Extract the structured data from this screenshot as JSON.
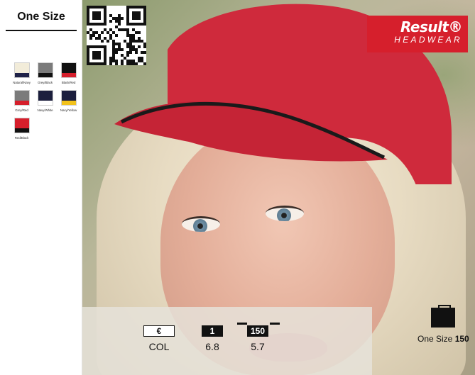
{
  "size_panel": {
    "title": "One Size"
  },
  "swatches": [
    {
      "label": "Natural/Navy",
      "main": "#f2ecd9",
      "band": "#1f2248"
    },
    {
      "label": "Grey/Black",
      "main": "#7b7b7b",
      "band": "#111111"
    },
    {
      "label": "Black/Red",
      "main": "#111111",
      "band": "#d61f2c"
    },
    {
      "label": "Grey/Red",
      "main": "#7b7b7b",
      "band": "#d61f2c"
    },
    {
      "label": "Navy/White",
      "main": "#1c1f3d",
      "band": "#ffffff"
    },
    {
      "label": "Navy/Yellow",
      "main": "#1c1f3d",
      "band": "#f2c21b"
    },
    {
      "label": "Red/Black",
      "main": "#d61f2c",
      "band": "#111111"
    }
  ],
  "logo": {
    "main": "Result®",
    "sub": "HEADWEAR",
    "color": "#d61f2c"
  },
  "info": {
    "currency_label": "€",
    "currency_value": "COL",
    "pack_label": "1",
    "pack_value": "6.8",
    "carton_label": "150",
    "carton_value": "5.7"
  },
  "size_tag": {
    "label": "One Size",
    "qty": "150"
  },
  "icons": {
    "qr": "qr-code-icon",
    "bag": "shopping-bag-icon"
  }
}
